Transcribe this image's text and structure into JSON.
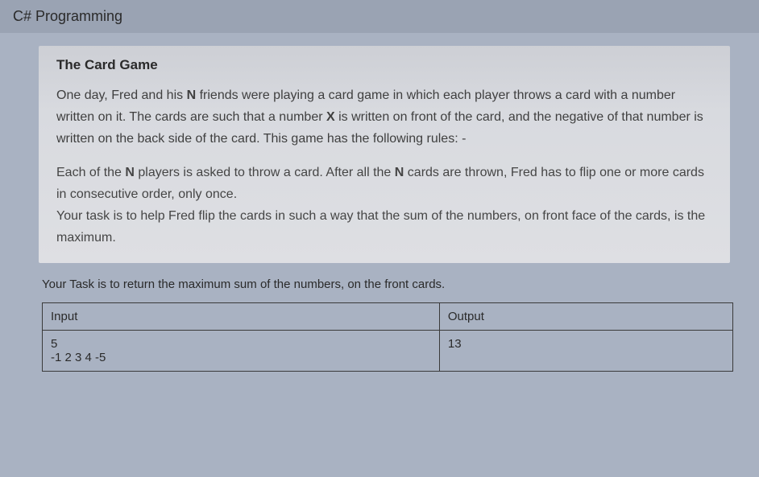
{
  "header": {
    "title": "C# Programming"
  },
  "problem": {
    "title": "The Card Game",
    "para1_pre": "One day, Fred and his ",
    "para1_bold1": "N",
    "para1_mid1": " friends were playing a card game in which each player throws a card with a number written on it. The cards are such that a number ",
    "para1_bold2": "X",
    "para1_post": " is written on front of the card, and the negative of that number is written on the back side of the card. This game has the following rules: -",
    "para2_pre": "Each of the ",
    "para2_bold1": "N",
    "para2_mid": " players is asked to throw a card. After all the ",
    "para2_bold2": "N",
    "para2_post": " cards are thrown, Fred has to flip one or more cards in consecutive order, only once.\nYour task is to help Fred flip the cards in such a way that the sum of the numbers, on front face of the cards, is the maximum."
  },
  "task_line": "Your Task is to return the maximum sum of the numbers, on the front cards.",
  "io_table": {
    "headers": [
      "Input",
      "Output"
    ],
    "rows": [
      {
        "input_lines": [
          "5",
          "-1 2 3 4 -5"
        ],
        "output_lines": [
          "13"
        ]
      }
    ]
  }
}
